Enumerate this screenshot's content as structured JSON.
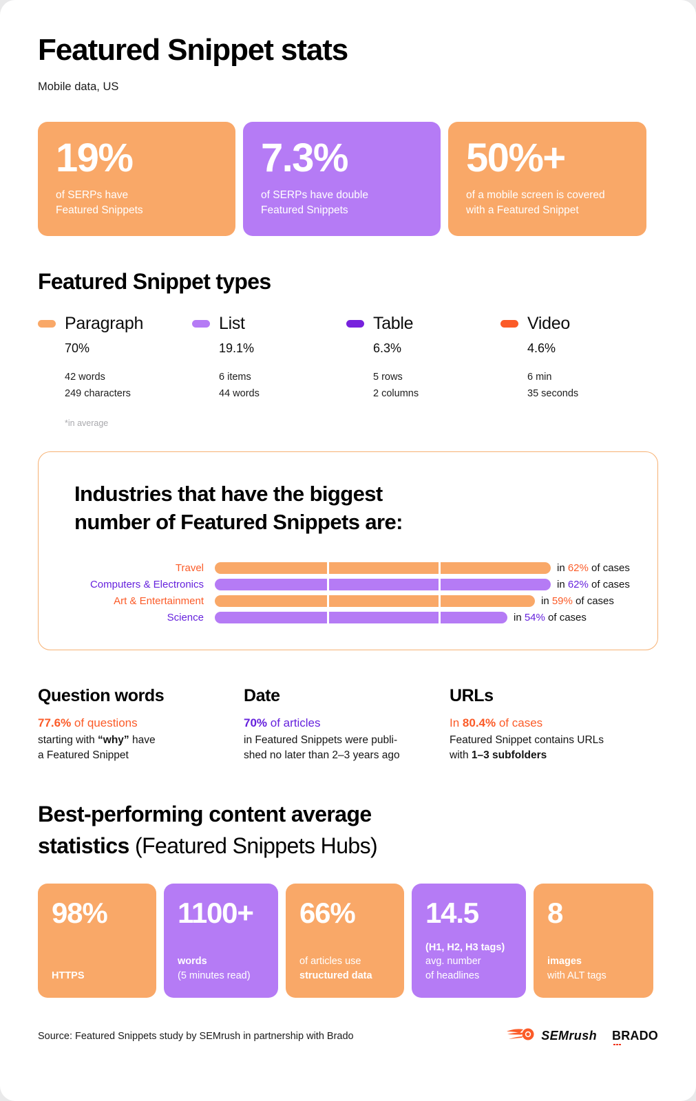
{
  "header": {
    "title": "Featured Snippet stats",
    "subtitle": "Mobile data, US"
  },
  "colors": {
    "orange": "#F9A868",
    "purple": "#B57BF5",
    "deep_purple": "#7722DD",
    "orange_red": "#FB5B28",
    "label_orange": "#FB5B28",
    "label_purple": "#6622DD",
    "card_border": "#F7B173"
  },
  "top_cards": [
    {
      "value": "19%",
      "caption": "of SERPs have\nFeatured Snippets",
      "color": "#F9A868"
    },
    {
      "value": "7.3%",
      "caption": "of SERPs have double\nFeatured Snippets",
      "color": "#B57BF5"
    },
    {
      "value": "50%+",
      "caption": "of a mobile screen is covered\nwith a Featured Snippet",
      "color": "#F9A868"
    }
  ],
  "types": {
    "heading": "Featured Snippet types",
    "footnote": "*in average",
    "items": [
      {
        "name": "Paragraph",
        "pct": "70%",
        "swatch": "#F9A868",
        "details": [
          "42 words",
          "249 characters"
        ]
      },
      {
        "name": "List",
        "pct": "19.1%",
        "swatch": "#B57BF5",
        "details": [
          "6 items",
          "44 words"
        ]
      },
      {
        "name": "Table",
        "pct": "6.3%",
        "swatch": "#7722DD",
        "details": [
          "5 rows",
          "2 columns"
        ]
      },
      {
        "name": "Video",
        "pct": "4.6%",
        "swatch": "#FB5B28",
        "details": [
          "6 min",
          "35 seconds"
        ]
      }
    ]
  },
  "industries": {
    "title": "Industries that have the biggest\nnumber of Featured Snippets are:"
  },
  "chart_data": {
    "type": "bar",
    "title": "Industries that have the biggest number of Featured Snippets are:",
    "orientation": "horizontal",
    "categories": [
      "Travel",
      "Computers & Electronics",
      "Art & Entertainment",
      "Science"
    ],
    "values": [
      62,
      62,
      59,
      54
    ],
    "unit": "%",
    "value_labels": [
      "in 62% of cases",
      "in 62% of cases",
      "in 59% of cases",
      "in 54% of cases"
    ],
    "bar_colors": [
      "#F9A868",
      "#B57BF5",
      "#F9A868",
      "#B57BF5"
    ],
    "label_colors": [
      "#FB5B28",
      "#6622DD",
      "#FB5B28",
      "#6622DD"
    ],
    "segments": 3,
    "xlabel": "",
    "ylabel": "",
    "xlim": [
      0,
      66
    ],
    "grid": false,
    "legend": false
  },
  "stats3": [
    {
      "heading": "Question words",
      "lead_value": "77.6%",
      "lead_rest": " of questions",
      "lead_color": "#FB5B28",
      "body_parts": [
        {
          "text": "starting with ",
          "bold": false
        },
        {
          "text": "“why”",
          "bold": true
        },
        {
          "text": " have",
          "bold": false
        },
        {
          "text": "\na Featured Snippet",
          "bold": false
        }
      ]
    },
    {
      "heading": "Date",
      "lead_value": "70%",
      "lead_rest": " of articles",
      "lead_color": "#6622DD",
      "body_parts": [
        {
          "text": "in Featured Snippets were publi-",
          "bold": false
        },
        {
          "text": "\nshed no later than 2–3 years ago",
          "bold": false
        }
      ]
    },
    {
      "heading": "URLs",
      "lead_prefix": "In ",
      "lead_value": "80.4%",
      "lead_rest": " of cases",
      "lead_color": "#FB5B28",
      "body_parts": [
        {
          "text": "Featured Snippet contains URLs",
          "bold": false
        },
        {
          "text": "\nwith ",
          "bold": false
        },
        {
          "text": "1–3 subfolders",
          "bold": true
        }
      ]
    }
  ],
  "best": {
    "title_bold": "Best-performing content average\nstatistics ",
    "title_regular": "(Featured Snippets Hubs)",
    "cards": [
      {
        "value": "98%",
        "color": "#F9A868",
        "lines": [
          {
            "text": "HTTPS",
            "bold": true
          }
        ]
      },
      {
        "value": "1100+",
        "color": "#B57BF5",
        "lines": [
          {
            "text": "words",
            "bold": true
          },
          {
            "text": "(5 minutes read)",
            "bold": false
          }
        ]
      },
      {
        "value": "66%",
        "color": "#F9A868",
        "lines": [
          {
            "text": "of articles use",
            "bold": false
          },
          {
            "text": "structured data",
            "bold": true
          }
        ]
      },
      {
        "value": "14.5",
        "color": "#B57BF5",
        "lines": [
          {
            "text": "(H1, H2, H3 tags)",
            "bold": true
          },
          {
            "text": "avg. number",
            "bold": false
          },
          {
            "text": "of headlines",
            "bold": false
          }
        ]
      },
      {
        "value": "8",
        "color": "#F9A868",
        "lines": [
          {
            "text": "images",
            "bold": true
          },
          {
            "text": "with ALT tags",
            "bold": false
          }
        ]
      }
    ]
  },
  "footer": {
    "source": "Source: Featured Snippets study by SEMrush in partnership with Brado",
    "semrush_wordmark": "SEMrush",
    "brado_wordmark": "BRADO"
  }
}
